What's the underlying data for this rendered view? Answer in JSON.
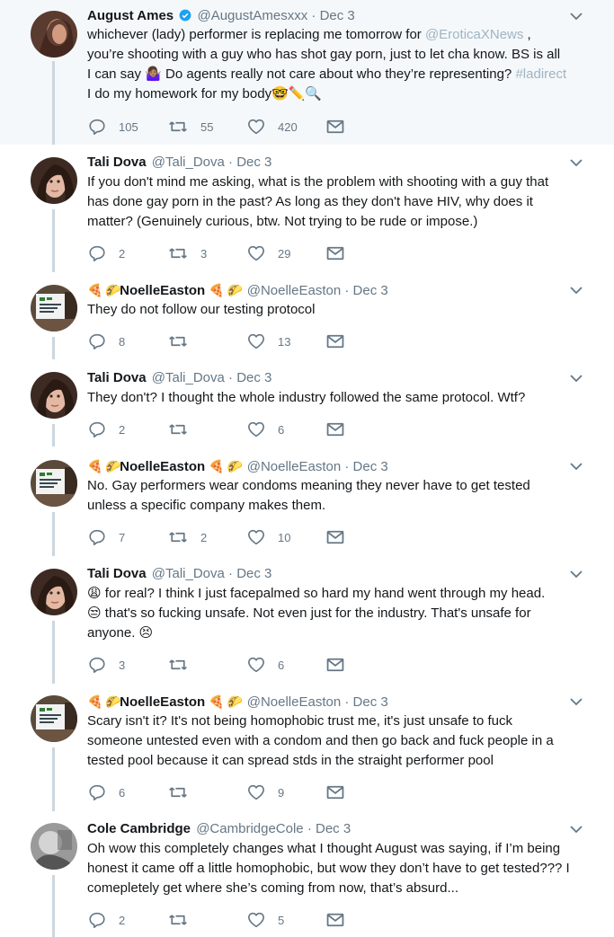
{
  "tweets": [
    {
      "name": "August Ames",
      "verified": true,
      "handle": "@AugustAmesxxx",
      "time": "Dec 3",
      "text_lines": [
        "whichever (lady) performer is replacing me tomorrow for @EroticaXNews ,",
        "you’re shooting with a guy who has shot gay porn, just to let cha know.  BS is all",
        "I can say 🤷🏽‍♀️ Do agents really not care about who they’re representing? #ladirect",
        "I do my homework for my body🤓✏️🔍"
      ],
      "replies": "105",
      "retweets": "55",
      "likes": "420"
    },
    {
      "name": "Tali Dova",
      "handle": "@Tali_Dova",
      "time": "Dec 3",
      "text_lines": [
        "If you don't mind me asking, what is the problem with shooting with a guy that",
        "has done gay porn in the past? As long as they don't have HIV, why does it",
        "matter? (Genuinely curious, btw. Not trying to be rude or impose.)"
      ],
      "replies": "2",
      "retweets": "3",
      "likes": "29"
    },
    {
      "name": "NoelleEaston",
      "handle": "@NoelleEaston",
      "time": "Dec 3",
      "text_lines": [
        "They do not follow our testing protocol"
      ],
      "replies": "8",
      "retweets": "",
      "likes": "13"
    },
    {
      "name": "Tali Dova",
      "handle": "@Tali_Dova",
      "time": "Dec 3",
      "text_lines": [
        "They don't? I thought the whole industry followed the same protocol. Wtf?"
      ],
      "replies": "2",
      "retweets": "",
      "likes": "6"
    },
    {
      "name": "NoelleEaston",
      "handle": "@NoelleEaston",
      "time": "Dec 3",
      "text_lines": [
        "No. Gay performers wear condoms meaning they never have to get tested",
        "unless a specific company makes them."
      ],
      "replies": "7",
      "retweets": "2",
      "likes": "10"
    },
    {
      "name": "Tali Dova",
      "handle": "@Tali_Dova",
      "time": "Dec 3",
      "text_lines": [
        "😩 for real? I think I just facepalmed so hard my hand went through my head.",
        "😒 that's so fucking unsafe. Not even just for the industry. That's unsafe for",
        "anyone. 😣"
      ],
      "replies": "3",
      "retweets": "",
      "likes": "6"
    },
    {
      "name": "NoelleEaston",
      "handle": "@NoelleEaston",
      "time": "Dec 3",
      "text_lines": [
        "Scary isn't it? It's not being homophobic trust me, it's just unsafe to fuck",
        "someone untested even with a condom and then go back and fuck people in a",
        "tested pool because it can spread stds in the straight performer pool"
      ],
      "replies": "6",
      "retweets": "",
      "likes": "9"
    },
    {
      "name": "Cole Cambridge",
      "handle": "@CambridgeCole",
      "time": "Dec 3",
      "text_lines": [
        "Oh wow this completely changes what I thought August was saying, if I’m being",
        "honest it came off a little homophobic, but wow they don’t have to get tested??? I",
        "comepletely get where she’s coming from now, that’s absurd..."
      ],
      "replies": "2",
      "retweets": "",
      "likes": "5"
    }
  ],
  "emoji": {
    "pizza": "🍕",
    "taco": "🌮",
    "dot": "·"
  },
  "colors": {
    "link": "#9fb4c4",
    "verified": "#1da1f2",
    "muted": "#657786",
    "line": "#ccd6dd"
  }
}
